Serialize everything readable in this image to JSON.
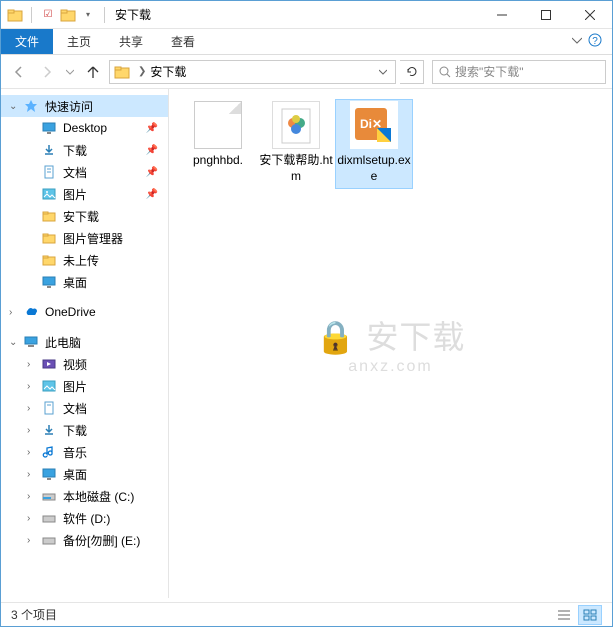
{
  "title": "安下载",
  "ribbon": {
    "file": "文件",
    "home": "主页",
    "share": "共享",
    "view": "查看"
  },
  "address": {
    "segment": "安下载"
  },
  "search": {
    "placeholder": "搜索\"安下载\""
  },
  "sidebar": {
    "quick": "快速访问",
    "quick_items": [
      {
        "label": "Desktop",
        "pin": true
      },
      {
        "label": "下载",
        "pin": true
      },
      {
        "label": "文档",
        "pin": true
      },
      {
        "label": "图片",
        "pin": true
      },
      {
        "label": "安下载",
        "pin": false
      },
      {
        "label": "图片管理器",
        "pin": false
      },
      {
        "label": "未上传",
        "pin": false
      },
      {
        "label": "桌面",
        "pin": false
      }
    ],
    "onedrive": "OneDrive",
    "thispc": "此电脑",
    "pc_items": [
      {
        "label": "视频"
      },
      {
        "label": "图片"
      },
      {
        "label": "文档"
      },
      {
        "label": "下载"
      },
      {
        "label": "音乐"
      },
      {
        "label": "桌面"
      },
      {
        "label": "本地磁盘 (C:)"
      },
      {
        "label": "软件 (D:)"
      },
      {
        "label": "备份[勿删] (E:)"
      }
    ]
  },
  "files": [
    {
      "name": "pnghhbd.",
      "type": "blank"
    },
    {
      "name": "安下载帮助.htm",
      "type": "htm"
    },
    {
      "name": "dixmlsetup.exe",
      "type": "exe"
    }
  ],
  "status": "3 个项目",
  "watermark": {
    "main": "安下载",
    "sub": "anxz.com"
  }
}
